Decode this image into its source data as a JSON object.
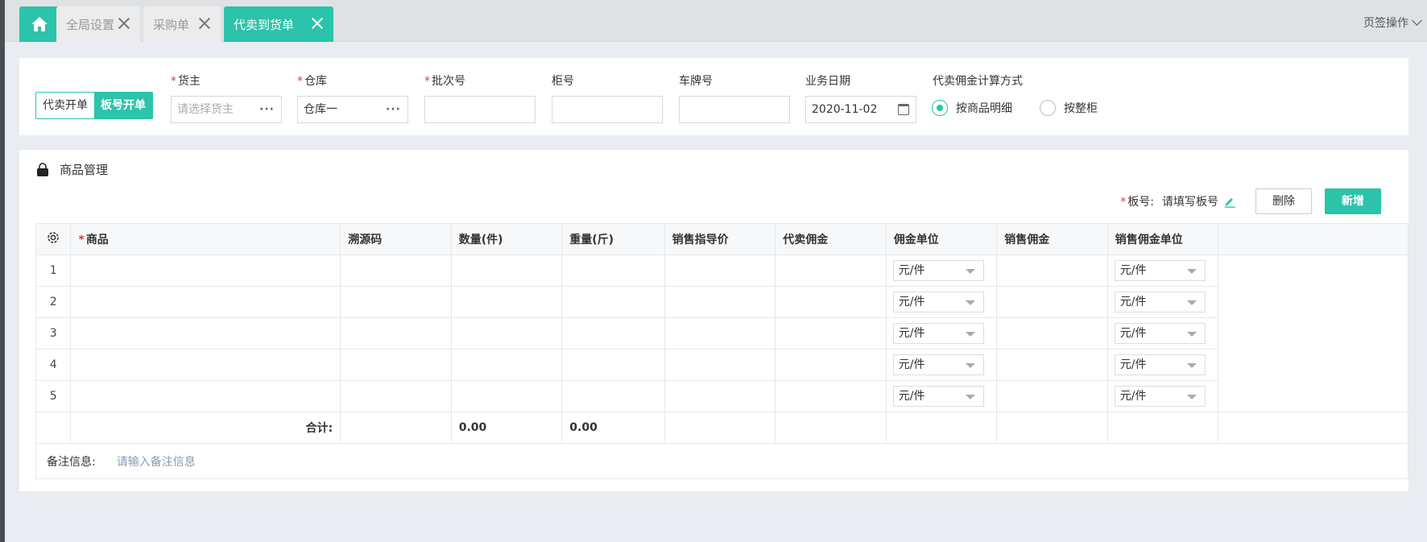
{
  "tabs": [
    {
      "label": "全局设置"
    },
    {
      "label": "采购单"
    },
    {
      "label": "代卖到货单"
    }
  ],
  "page_ops": {
    "label": "页签操作"
  },
  "form": {
    "mode_options": [
      "代卖开单",
      "板号开单"
    ],
    "required_mark": "*",
    "owner": {
      "label": "货主",
      "placeholder": "请选择货主"
    },
    "warehouse": {
      "label": "仓库",
      "value": "仓库一"
    },
    "batch": {
      "label": "批次号",
      "value": ""
    },
    "cabinet": {
      "label": "柜号",
      "value": ""
    },
    "plate": {
      "label": "车牌号",
      "value": ""
    },
    "date": {
      "label": "业务日期",
      "value": "2020-11-02"
    },
    "commission_method": {
      "label": "代卖佣金计算方式",
      "options": [
        "按商品明细",
        "按整柜"
      ],
      "selected": "按商品明细"
    }
  },
  "goods": {
    "title": "商品管理",
    "board_label": "板号:",
    "board_value": "请填写板号",
    "delete_label": "删除",
    "add_label": "新增",
    "columns": [
      "商品",
      "溯源码",
      "数量(件)",
      "重量(斤)",
      "销售指导价",
      "代卖佣金",
      "佣金单位",
      "销售佣金",
      "销售佣金单位"
    ],
    "rows": [
      {
        "index": "1",
        "commission_unit": "元/件",
        "sale_commission_unit": "元/件"
      },
      {
        "index": "2",
        "commission_unit": "元/件",
        "sale_commission_unit": "元/件"
      },
      {
        "index": "3",
        "commission_unit": "元/件",
        "sale_commission_unit": "元/件"
      },
      {
        "index": "4",
        "commission_unit": "元/件",
        "sale_commission_unit": "元/件"
      },
      {
        "index": "5",
        "commission_unit": "元/件",
        "sale_commission_unit": "元/件"
      }
    ],
    "summary": {
      "label": "合计:",
      "quantity": "0.00",
      "weight": "0.00"
    },
    "remark": {
      "label": "备注信息:",
      "placeholder": "请输入备注信息"
    }
  },
  "colors": {
    "accent": "#2bc3a9",
    "required": "#e4393c"
  }
}
